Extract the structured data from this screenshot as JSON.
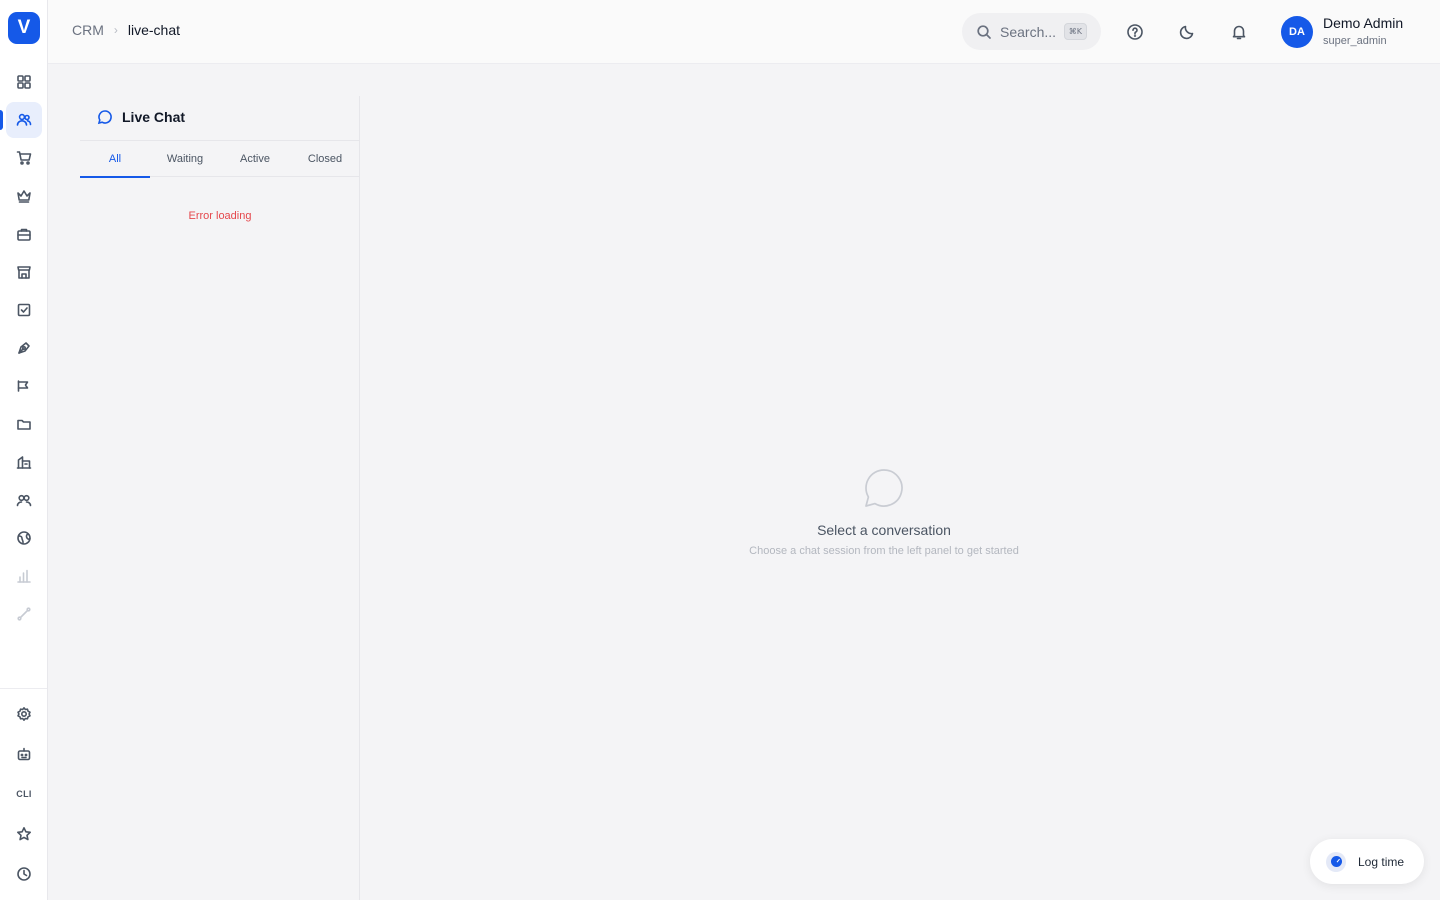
{
  "app": {
    "logo_letter": "V",
    "accent_color": "#1559e8"
  },
  "sidebar": {
    "items": [
      {
        "icon": "dashboard-grid-icon"
      },
      {
        "icon": "users-icon",
        "active": true
      },
      {
        "icon": "cart-icon"
      },
      {
        "icon": "crown-icon"
      },
      {
        "icon": "briefcase-icon"
      },
      {
        "icon": "store-icon"
      },
      {
        "icon": "checkbox-icon"
      },
      {
        "icon": "pen-tool-icon"
      },
      {
        "icon": "megaphone-icon"
      },
      {
        "icon": "folder-icon"
      },
      {
        "icon": "building-icon"
      },
      {
        "icon": "team-icon"
      },
      {
        "icon": "globe-icon"
      },
      {
        "icon": "bar-chart-icon",
        "disabled": true
      },
      {
        "icon": "route-icon",
        "disabled": true
      }
    ],
    "bottom": [
      {
        "icon": "settings-icon"
      },
      {
        "icon": "bot-icon"
      },
      {
        "icon": "cli-icon",
        "label": "CLI"
      },
      {
        "icon": "star-icon"
      },
      {
        "icon": "clock-icon"
      }
    ]
  },
  "header": {
    "breadcrumb": {
      "root": "CRM",
      "current": "live-chat"
    },
    "search": {
      "placeholder": "Search...",
      "shortcut": "⌘K"
    },
    "user": {
      "initials": "DA",
      "name": "Demo Admin",
      "role": "super_admin"
    }
  },
  "chat_panel": {
    "title": "Live Chat",
    "tabs": [
      {
        "label": "All",
        "active": true
      },
      {
        "label": "Waiting"
      },
      {
        "label": "Active"
      },
      {
        "label": "Closed"
      }
    ],
    "error": "Error loading"
  },
  "empty_state": {
    "title": "Select a conversation",
    "subtitle": "Choose a chat session from the left panel to get started"
  },
  "log_time": {
    "label": "Log time"
  }
}
